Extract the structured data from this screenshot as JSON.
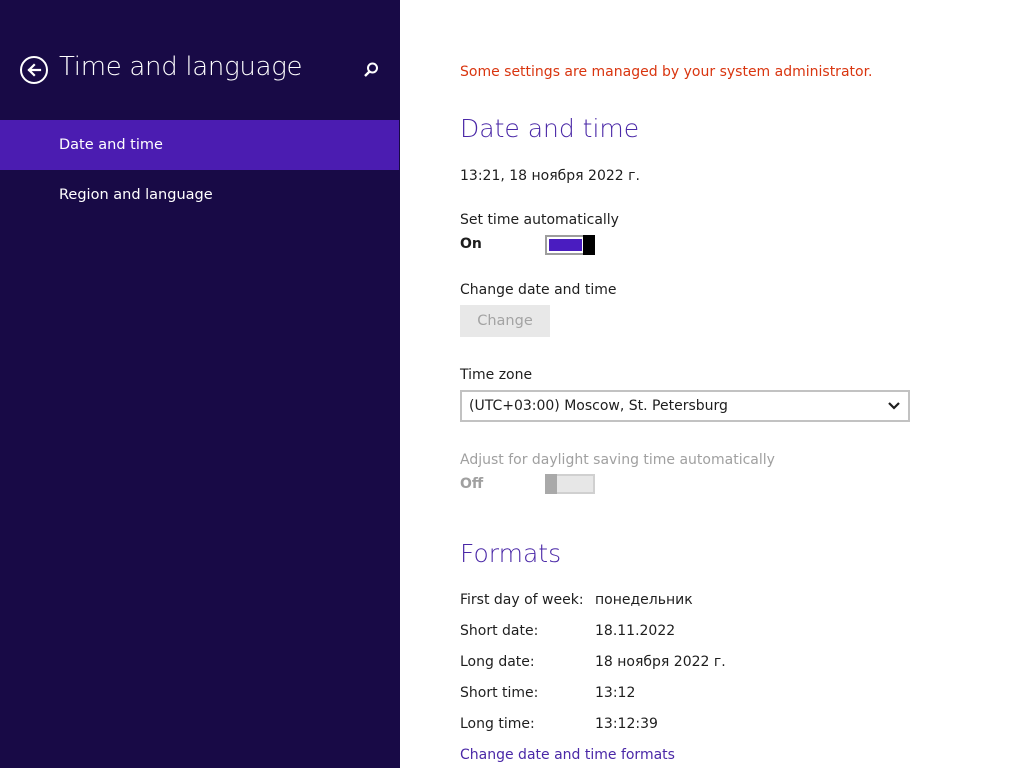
{
  "sidebar": {
    "title": "Time and language",
    "back_icon": "back-arrow-icon",
    "search_icon": "search-icon",
    "items": [
      {
        "label": "Date and time",
        "selected": true
      },
      {
        "label": "Region and language",
        "selected": false
      }
    ]
  },
  "main": {
    "admin_note": "Some settings are managed by your system administrator.",
    "date_time": {
      "heading": "Date and time",
      "current": "13:21, 18 ноября 2022 г.",
      "set_auto": {
        "label": "Set time automatically",
        "state": "On"
      },
      "change": {
        "label": "Change date and time",
        "button": "Change"
      },
      "time_zone": {
        "label": "Time zone",
        "value": "(UTC+03:00) Moscow, St. Petersburg"
      },
      "dst": {
        "label": "Adjust for daylight saving time automatically",
        "state": "Off"
      }
    },
    "formats": {
      "heading": "Formats",
      "rows": [
        {
          "label": "First day of week:",
          "value": "понедельник"
        },
        {
          "label": "Short date:",
          "value": "18.11.2022"
        },
        {
          "label": "Long date:",
          "value": "18 ноября 2022 г."
        },
        {
          "label": "Short time:",
          "value": "13:12"
        },
        {
          "label": "Long time:",
          "value": "13:12:39"
        }
      ],
      "link": "Change date and time formats"
    }
  },
  "colors": {
    "sidebar_bg": "#180a46",
    "selected_bg": "#4b1cb1",
    "accent": "#4a28a7",
    "warning": "#d9350f"
  }
}
